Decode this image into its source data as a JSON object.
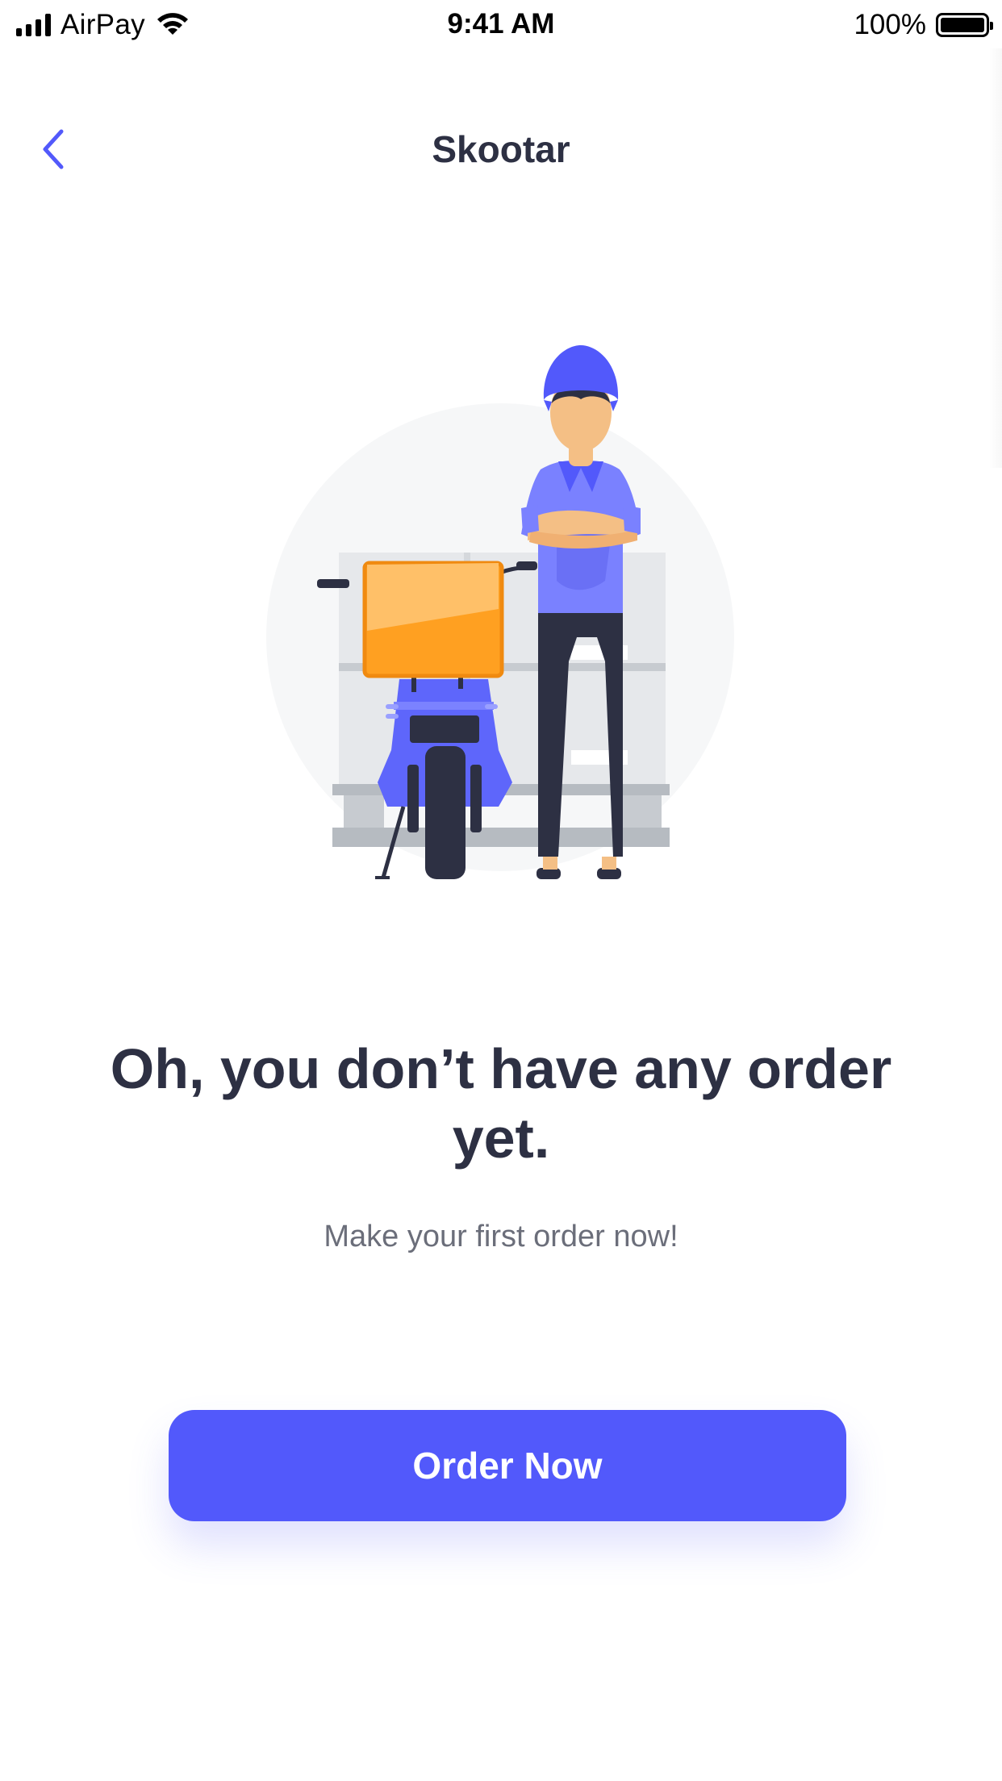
{
  "status_bar": {
    "carrier": "AirPay",
    "time": "9:41 AM",
    "battery_percent": "100%",
    "battery_level": 1.0,
    "icons": [
      "signal-bars-icon",
      "wifi-icon",
      "battery-icon"
    ]
  },
  "nav": {
    "title": "Skootar",
    "back_icon": "chevron-left-icon"
  },
  "empty_state": {
    "illustration": "delivery-rider-with-scooter",
    "headline": "Oh, you don’t have any order yet.",
    "subtext": "Make your first order now!"
  },
  "cta": {
    "label": "Order Now"
  },
  "colors": {
    "accent": "#5259fb",
    "back_icon": "#5259fb",
    "title_text": "#2d3043",
    "subtext": "#6b6e7a",
    "delivery_box": "#ffa021",
    "rider_shirt": "#7a81ff",
    "background": "#ffffff"
  }
}
